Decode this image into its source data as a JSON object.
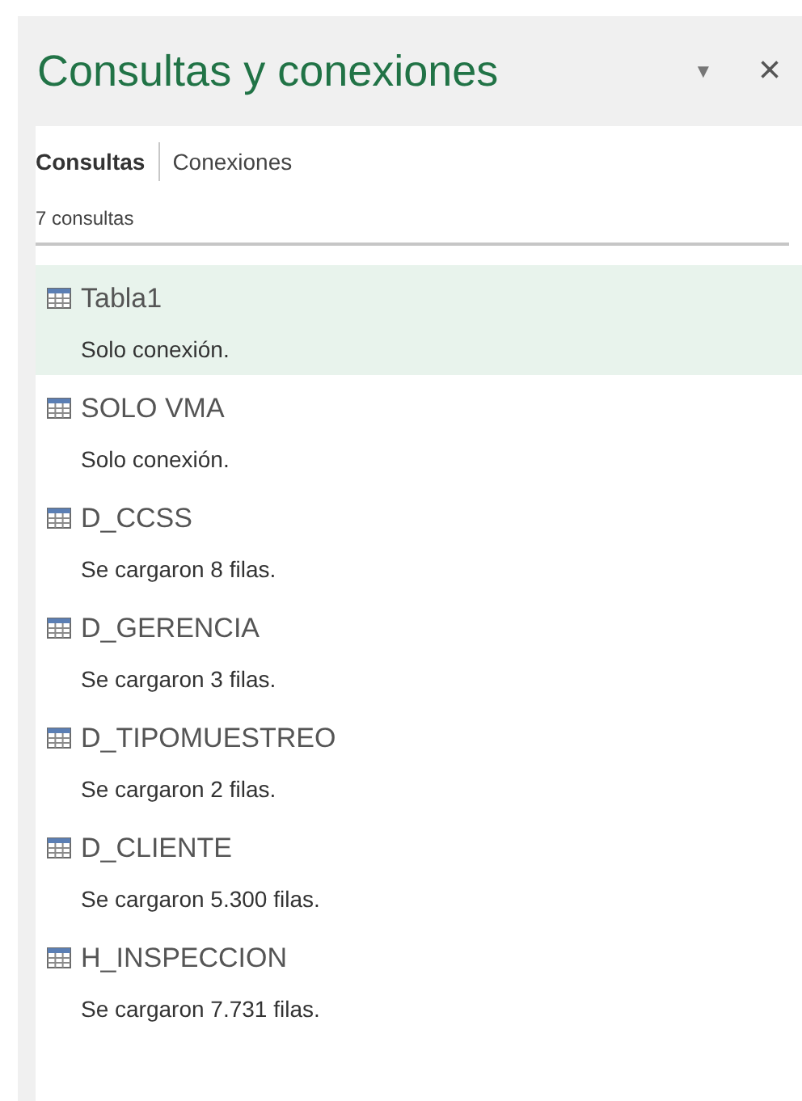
{
  "pane": {
    "title": "Consultas y conexiones",
    "menu_glyph": "▼",
    "close_glyph": "×"
  },
  "tabs": [
    {
      "label": "Consultas",
      "selected": true
    },
    {
      "label": "Conexiones",
      "selected": false
    }
  ],
  "count": "7 consultas",
  "queries": [
    {
      "name": "Tabla1",
      "status": "Solo conexión.",
      "selected": true
    },
    {
      "name": "SOLO VMA",
      "status": "Solo conexión.",
      "selected": false
    },
    {
      "name": "D_CCSS",
      "status": "Se cargaron 8 filas.",
      "selected": false
    },
    {
      "name": "D_GERENCIA",
      "status": "Se cargaron 3 filas.",
      "selected": false
    },
    {
      "name": "D_TIPOMUESTREO",
      "status": "Se cargaron 2 filas.",
      "selected": false
    },
    {
      "name": "D_CLIENTE",
      "status": "Se cargaron 5.300 filas.",
      "selected": false
    },
    {
      "name": "H_INSPECCION",
      "status": "Se cargaron 7.731 filas.",
      "selected": false
    }
  ]
}
